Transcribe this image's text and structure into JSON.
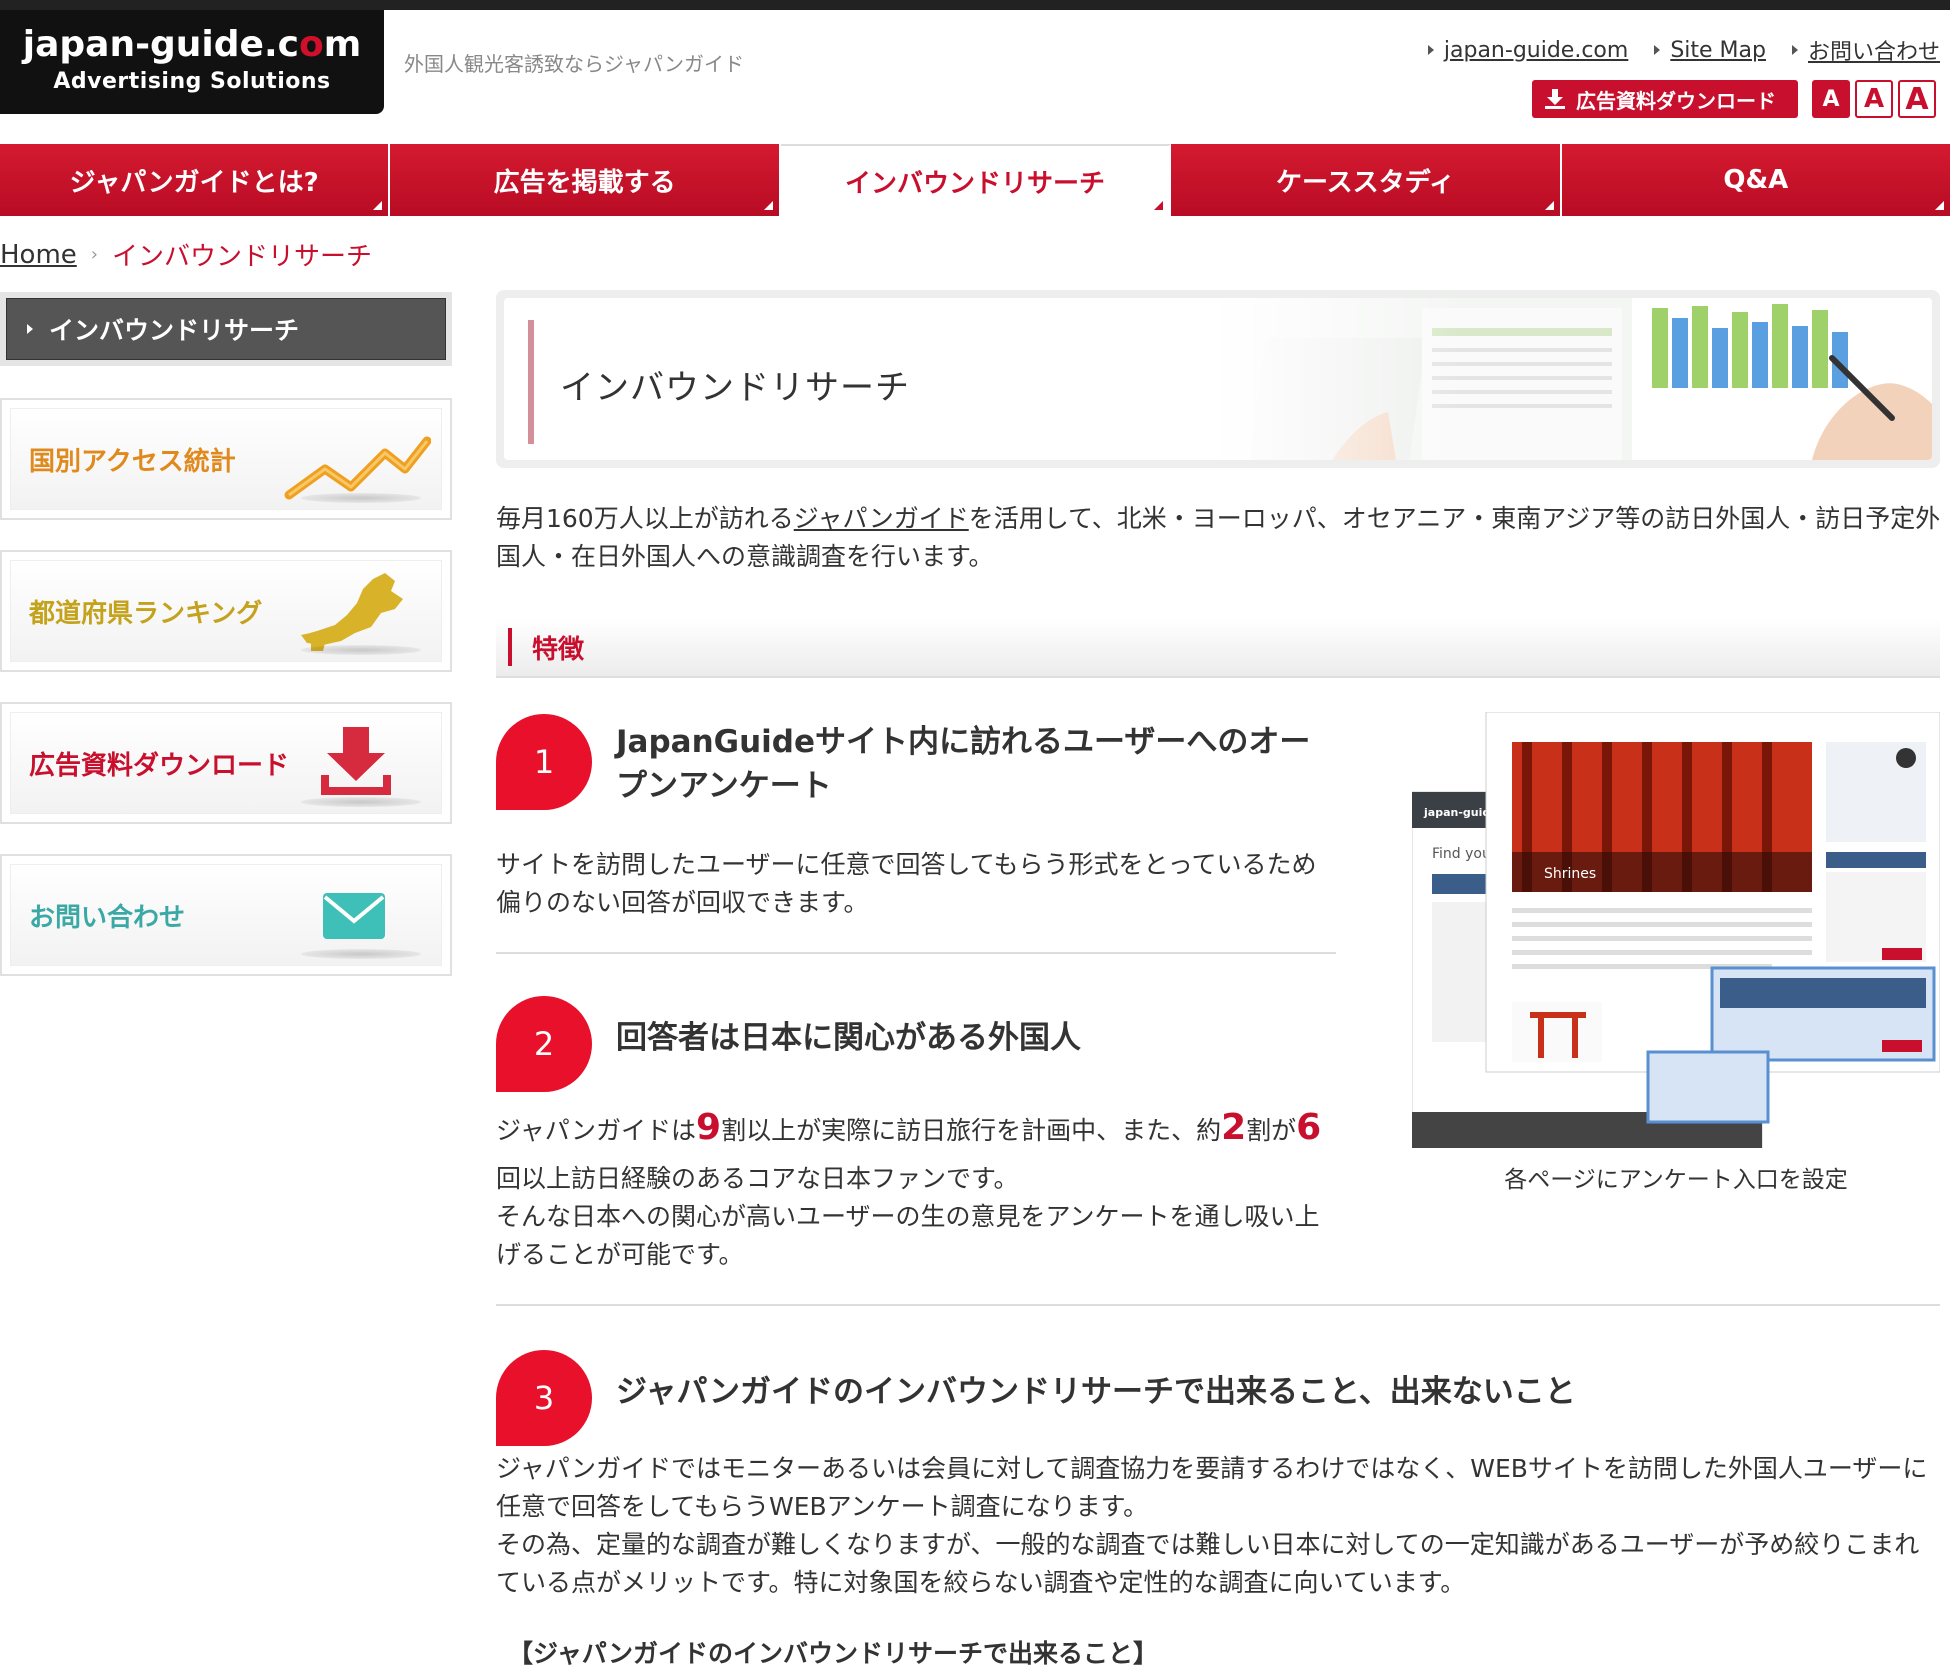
{
  "header": {
    "logo_line1_a": "japan-guide.c",
    "logo_line1_o": "o",
    "logo_line1_b": "m",
    "logo_line2": "Advertising Solutions",
    "tagline": "外国人観光客誘致ならジャパンガイド",
    "links": [
      "japan-guide.com",
      "Site Map",
      "お問い合わせ"
    ],
    "download_label": "広告資料ダウンロード",
    "font_sizes": [
      "A",
      "A",
      "A"
    ]
  },
  "nav": {
    "items": [
      "ジャパンガイドとは?",
      "広告を掲載する",
      "インバウンドリサーチ",
      "ケーススタディ",
      "Q&A"
    ],
    "active_index": 2
  },
  "breadcrumb": {
    "home": "Home",
    "current": "インバウンドリサーチ"
  },
  "sidebar": {
    "heading": "インバウンドリサーチ",
    "banners": [
      {
        "label": "国別アクセス統計",
        "color": "#e08a1e",
        "icon": "trend-chart-icon"
      },
      {
        "label": "都道府県ランキング",
        "color": "#c4a21c",
        "icon": "japan-map-icon"
      },
      {
        "label": "広告資料ダウンロード",
        "color": "#c8102e",
        "icon": "download-icon"
      },
      {
        "label": "お問い合わせ",
        "color": "#3aa9a5",
        "icon": "mail-icon"
      }
    ]
  },
  "main": {
    "hero_title": "インバウンドリサーチ",
    "intro_pre": "毎月160万人以上が訪れる",
    "intro_link": "ジャパンガイド",
    "intro_post": "を活用して、北米・ヨーロッパ、オセアニア・東南アジア等の訪日外国人・訪日予定外国人・在日外国人への意識調査を行います。",
    "section_title": "特徴",
    "features": [
      {
        "num": "1",
        "title": "JapanGuideサイト内に訪れるユーザーへのオープンアンケート",
        "body": "サイトを訪問したユーザーに任意で回答してもらう形式をとっているため偏りのない回答が回収できます。"
      },
      {
        "num": "2",
        "title": "回答者は日本に関心がある外国人",
        "body_parts": [
          "ジャパンガイドは",
          "9",
          "割以上が実際に訪日旅行を計画中、また、約",
          "2",
          "割が",
          "6",
          "回以上訪日経験のあるコアな日本ファンです。"
        ],
        "body2": "そんな日本への関心が高いユーザーの生の意見をアンケートを通し吸い上げることが可能です。"
      },
      {
        "num": "3",
        "title": "ジャパンガイドのインバウンドリサーチで出来ること、出来ないこと",
        "body": "ジャパンガイドではモニターあるいは会員に対して調査協力を要請するわけではなく、WEBサイトを訪問した外国人ユーザーに任意で回答をしてもらうWEBアンケート調査になります。",
        "body2": "その為、定量的な調査が難しくなりますが、一般的な調査では難しい日本に対しての一定知識があるユーザーが予め絞りこまれている点がメリットです。特に対象国を絞らない調査や定性的な調査に向いています。"
      }
    ],
    "screenshot": {
      "site_label": "japan-guide.c",
      "find_label": "Find your",
      "page_label": "Shrines",
      "caption": "各ページにアンケート入口を設定"
    },
    "subhead": "【ジャパンガイドのインバウンドリサーチで出来ること】"
  }
}
